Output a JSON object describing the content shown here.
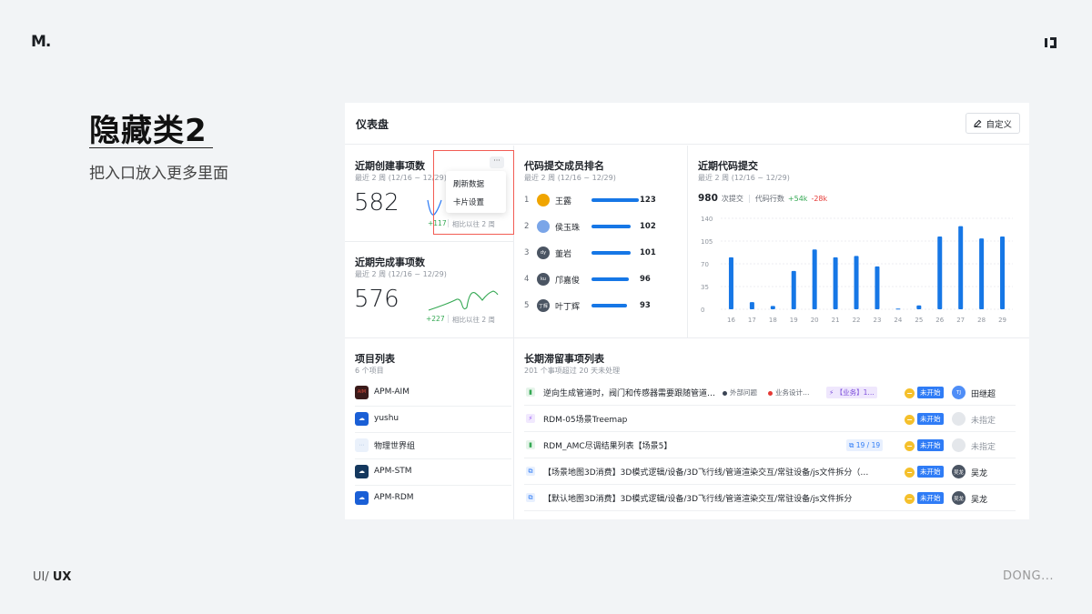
{
  "slide": {
    "logo": "M.",
    "title": "隐藏类2",
    "subtitle": "把入口放入更多里面",
    "footer_left_a": "UI/",
    "footer_left_b": "UX",
    "footer_right": "DONG..."
  },
  "dashboard": {
    "title": "仪表盘",
    "customize_label": "自定义"
  },
  "card_created": {
    "title": "近期创建事项数",
    "subtitle": "最近 2 周 (12/16 ~ 12/29)",
    "value": "582",
    "delta": "+117",
    "compare": "相比以往 2 周",
    "more": "···",
    "menu": [
      "刷新数据",
      "卡片设置"
    ]
  },
  "card_done": {
    "title": "近期完成事项数",
    "subtitle": "最近 2 周 (12/16 ~ 12/29)",
    "value": "576",
    "delta": "+227",
    "compare": "相比以往 2 周"
  },
  "card_rank": {
    "title": "代码提交成员排名",
    "subtitle": "最近 2 周 (12/16 ~ 12/29)",
    "rows": [
      {
        "rank": "1",
        "name": "王露",
        "value": 123,
        "value_text": "123",
        "avatar": ""
      },
      {
        "rank": "2",
        "name": "侯玉珠",
        "value": 102,
        "value_text": "102",
        "avatar": ""
      },
      {
        "rank": "3",
        "name": "董岩",
        "value": 101,
        "value_text": "101",
        "avatar": "dy"
      },
      {
        "rank": "4",
        "name": "邝嘉俊",
        "value": 96,
        "value_text": "96",
        "avatar": "ku"
      },
      {
        "rank": "5",
        "name": "叶丁辉",
        "value": 93,
        "value_text": "93",
        "avatar": "丁辉"
      }
    ],
    "bar_color": "#1677e6"
  },
  "card_commits": {
    "title": "近期代码提交",
    "subtitle": "最近 2 周 (12/16 ~ 12/29)",
    "total": "980",
    "total_label": "次提交",
    "lines_label": "代码行数",
    "added": "+54k",
    "removed": "-28k"
  },
  "chart_data": {
    "type": "bar",
    "categories": [
      "16",
      "17",
      "18",
      "19",
      "20",
      "21",
      "22",
      "23",
      "24",
      "25",
      "26",
      "27",
      "28",
      "29"
    ],
    "values": [
      80,
      11,
      5,
      59,
      92,
      80,
      82,
      66,
      1,
      6,
      112,
      128,
      109,
      112
    ],
    "yticks": [
      "0",
      "35",
      "70",
      "105",
      "140"
    ],
    "ylim": [
      0,
      140
    ],
    "color": "#1677e6",
    "grid": true
  },
  "card_projects": {
    "title": "项目列表",
    "subtitle": "6 个项目",
    "items": [
      {
        "name": "APM-AIM",
        "icon": "AIM",
        "color": "#3a1a1a"
      },
      {
        "name": "yushu",
        "icon": "yushu-icon",
        "color": "#1a5fd6"
      },
      {
        "name": "物理世界组",
        "icon": "dots-icon",
        "color": "#eaf1fb"
      },
      {
        "name": "APM-STM",
        "icon": "cloud-icon",
        "color": "#14385e"
      },
      {
        "name": "APM-RDM",
        "icon": "rdm-icon",
        "color": "#1a5fd6"
      }
    ]
  },
  "card_issues": {
    "title": "长期滞留事项列表",
    "subtitle": "201 个事项超过 20 天未处理",
    "rows": [
      {
        "icon": "▮",
        "icon_color": "#34a853",
        "icon_bg": "#e6f4ea",
        "title": "逆向生成管道时，阀门和传感器需要跟随管道…",
        "tags": [
          "外部问题",
          "业务设计…",
          "【业务】1…"
        ],
        "priority": "−",
        "status": "未开始",
        "assignee": "田继超",
        "assignee_av": "TJ",
        "av_color": "#4f8ef7"
      },
      {
        "icon": "⚡",
        "icon_color": "#9b59f6",
        "icon_bg": "#f1e9fe",
        "title": "RDM-05场景Treemap",
        "tags": [],
        "priority": "−",
        "status": "未开始",
        "assignee": "未指定",
        "assignee_av": "",
        "av_color": "#e4e7eb"
      },
      {
        "icon": "▮",
        "icon_color": "#34a853",
        "icon_bg": "#e6f4ea",
        "title": "RDM_AMC尽调结果列表【场景5】",
        "tags": [
          "19 / 19"
        ],
        "priority": "−",
        "status": "未开始",
        "assignee": "未指定",
        "assignee_av": "",
        "av_color": "#e4e7eb"
      },
      {
        "icon": "⧉",
        "icon_color": "#2f7cf6",
        "icon_bg": "#e8f0fe",
        "title": "【场景地图3D消费】3D模式逻辑/设备/3D飞行线/管道渲染交互/常驻设备/js文件拆分（…",
        "tags": [],
        "priority": "−",
        "status": "未开始",
        "assignee": "吴龙",
        "assignee_av": "吴龙",
        "av_color": "#4b5563"
      },
      {
        "icon": "⧉",
        "icon_color": "#2f7cf6",
        "icon_bg": "#e8f0fe",
        "title": "【默认地图3D消费】3D模式逻辑/设备/3D飞行线/管道渲染交互/常驻设备/js文件拆分",
        "tags": [],
        "priority": "−",
        "status": "未开始",
        "assignee": "吴龙",
        "assignee_av": "吴龙",
        "av_color": "#4b5563"
      }
    ]
  }
}
